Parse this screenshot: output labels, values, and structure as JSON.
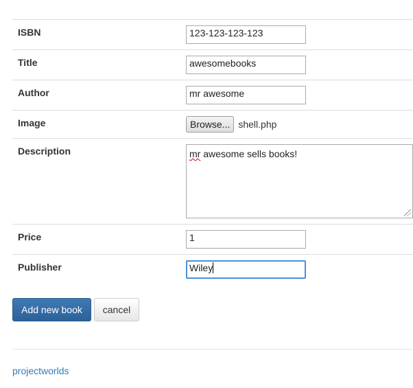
{
  "form": {
    "fields": {
      "isbn": {
        "label": "ISBN",
        "value": "123-123-123-123"
      },
      "title": {
        "label": "Title",
        "value": "awesomebooks"
      },
      "author": {
        "label": "Author",
        "value": "mr awesome"
      },
      "image": {
        "label": "Image",
        "button": "Browse...",
        "file_name": "shell.php"
      },
      "description": {
        "label": "Description",
        "value_misspelled": "mr",
        "value_rest": " awesome sells books!"
      },
      "price": {
        "label": "Price",
        "value": "1"
      },
      "publisher": {
        "label": "Publisher",
        "value": "Wiley"
      }
    },
    "submit_label": "Add new book",
    "cancel_label": "cancel"
  },
  "footer": {
    "link": "projectworlds"
  },
  "colors": {
    "primary_button": "#2c6198",
    "link": "#337ab7",
    "focus_border": "#4a90d9",
    "row_border": "#dddddd"
  }
}
